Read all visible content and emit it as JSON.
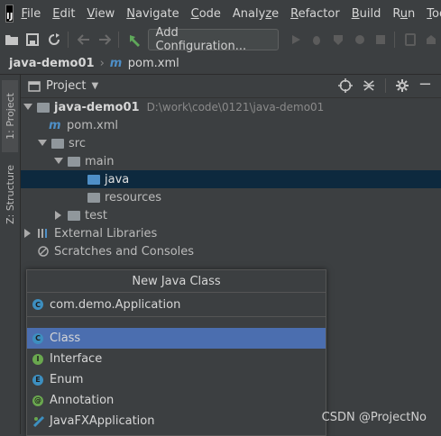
{
  "menu": [
    "File",
    "Edit",
    "View",
    "Navigate",
    "Code",
    "Analyze",
    "Refactor",
    "Build",
    "Run",
    "Tools"
  ],
  "menu_mnemonics": [
    "F",
    "E",
    "V",
    "N",
    "C",
    "z",
    "R",
    "B",
    "u",
    "T"
  ],
  "toolbar": {
    "add_configuration": "Add Configuration..."
  },
  "breadcrumb": {
    "project": "java-demo01",
    "file": "pom.xml"
  },
  "sidebar_tabs": {
    "project": "1: Project",
    "structure": "Z: Structure"
  },
  "panel": {
    "title": "Project"
  },
  "tree": {
    "root": "java-demo01",
    "root_path": "D:\\work\\code\\0121\\java-demo01",
    "pom": "pom.xml",
    "src": "src",
    "main": "main",
    "java": "java",
    "resources": "resources",
    "test": "test",
    "external": "External Libraries",
    "scratches": "Scratches and Consoles"
  },
  "popup": {
    "title": "New Java Class",
    "input_value": "com.demo.Application",
    "items": [
      {
        "label": "Class",
        "icon": "C",
        "color": "#3d8fc0"
      },
      {
        "label": "Interface",
        "icon": "I",
        "color": "#6aa84f"
      },
      {
        "label": "Enum",
        "icon": "E",
        "color": "#3d8fc0"
      },
      {
        "label": "Annotation",
        "icon": "@",
        "color": "#6aa84f"
      },
      {
        "label": "JavaFXApplication",
        "icon": "fx",
        "color": "#3d8fc0"
      }
    ]
  },
  "watermark": "CSDN @ProjectNo"
}
